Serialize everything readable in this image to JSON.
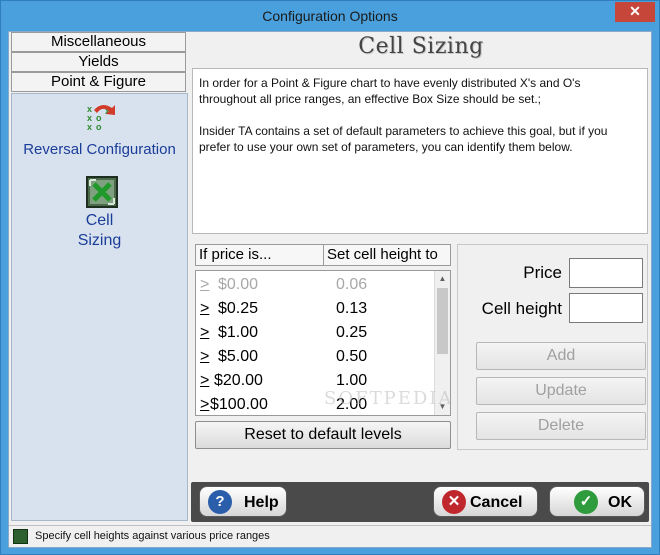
{
  "window": {
    "title": "Configuration Options",
    "close_glyph": "✕"
  },
  "nav": {
    "tabs": [
      "Miscellaneous",
      "Yields",
      "Point & Figure"
    ],
    "items": [
      {
        "label": "Reversal Configuration",
        "icon": "reversal-config-icon"
      },
      {
        "label_line1": "Cell",
        "label_line2": "Sizing",
        "icon": "cell-sizing-icon"
      }
    ]
  },
  "main": {
    "heading": "Cell Sizing",
    "description_p1": "In order for a Point & Figure chart to have evenly distributed X's and O's throughout all price ranges, an effective Box Size should be set.;",
    "description_p2": "Insider TA contains a set of default parameters to achieve this goal, but if you prefer to use your own set of parameters, you can identify them below."
  },
  "table": {
    "headers": [
      "If price is...",
      "Set cell height to"
    ],
    "rows": [
      {
        "gt": ">",
        "price": "$0.00",
        "cell": "0.06",
        "dim": true
      },
      {
        "gt": ">",
        "price": "$0.25",
        "cell": "0.13"
      },
      {
        "gt": ">",
        "price": "$1.00",
        "cell": "0.25"
      },
      {
        "gt": ">",
        "price": "$5.00",
        "cell": "0.50"
      },
      {
        "gt": ">",
        "price": "$20.00",
        "cell": "1.00"
      },
      {
        "gt": ">",
        "price": "$100.00",
        "cell": "2.00"
      }
    ],
    "reset_label": "Reset to default levels"
  },
  "editor": {
    "price_label": "Price",
    "price_value": "",
    "cell_label": "Cell height",
    "cell_value": "",
    "add_label": "Add",
    "update_label": "Update",
    "delete_label": "Delete"
  },
  "footer": {
    "help_label": "Help",
    "cancel_label": "Cancel",
    "ok_label": "OK"
  },
  "status": {
    "text": "Specify cell heights against various price ranges"
  },
  "watermark": "SOFTPEDIA",
  "colors": {
    "accent": "#4aa0dc",
    "nav_text": "#1b3d9a",
    "cancel": "#c0272d",
    "ok": "#2e9b3c",
    "help": "#2b5eaa"
  }
}
